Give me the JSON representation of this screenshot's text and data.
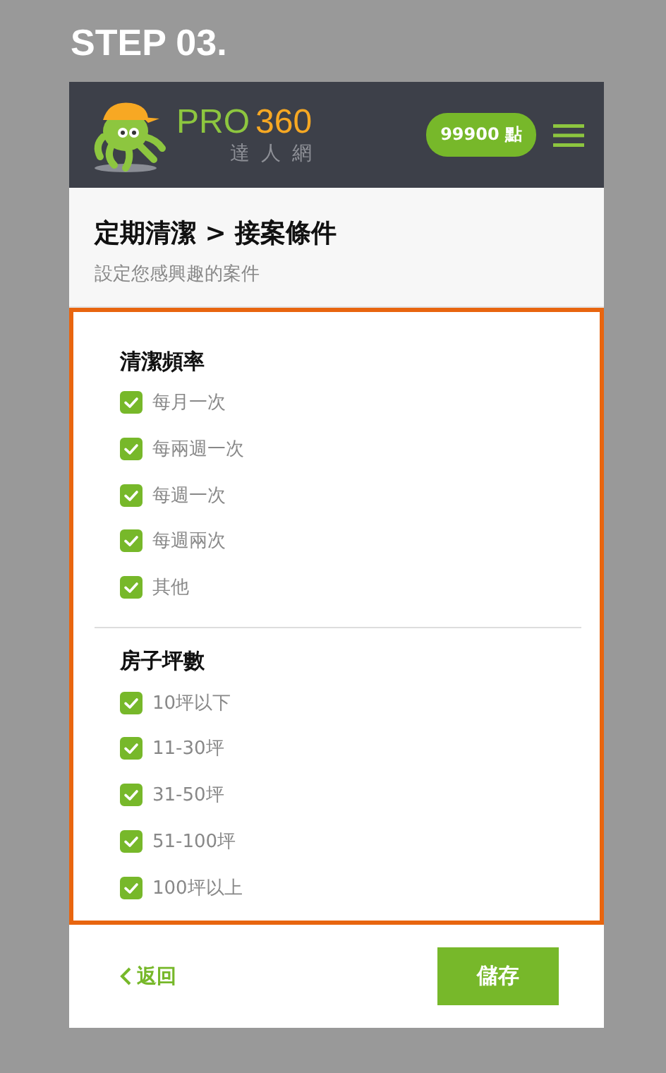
{
  "step_title": "STEP 03.",
  "header": {
    "logo": {
      "brand_a": "PRO",
      "brand_b": "360",
      "subtitle": "達人網"
    },
    "points": "99900 點"
  },
  "page": {
    "title": "定期清潔 > 接案條件",
    "subtitle": "設定您感興趣的案件"
  },
  "sections": [
    {
      "heading": "清潔頻率",
      "options": [
        {
          "label": "每月一次",
          "checked": true
        },
        {
          "label": "每兩週一次",
          "checked": true
        },
        {
          "label": "每週一次",
          "checked": true
        },
        {
          "label": "每週兩次",
          "checked": true
        },
        {
          "label": "其他",
          "checked": true
        }
      ]
    },
    {
      "heading": "房子坪數",
      "options": [
        {
          "label": "10坪以下",
          "checked": true
        },
        {
          "label": "11-30坪",
          "checked": true
        },
        {
          "label": "31-50坪",
          "checked": true
        },
        {
          "label": "51-100坪",
          "checked": true
        },
        {
          "label": "100坪以上",
          "checked": true
        }
      ]
    }
  ],
  "footer": {
    "back": "返回",
    "save": "儲存"
  }
}
